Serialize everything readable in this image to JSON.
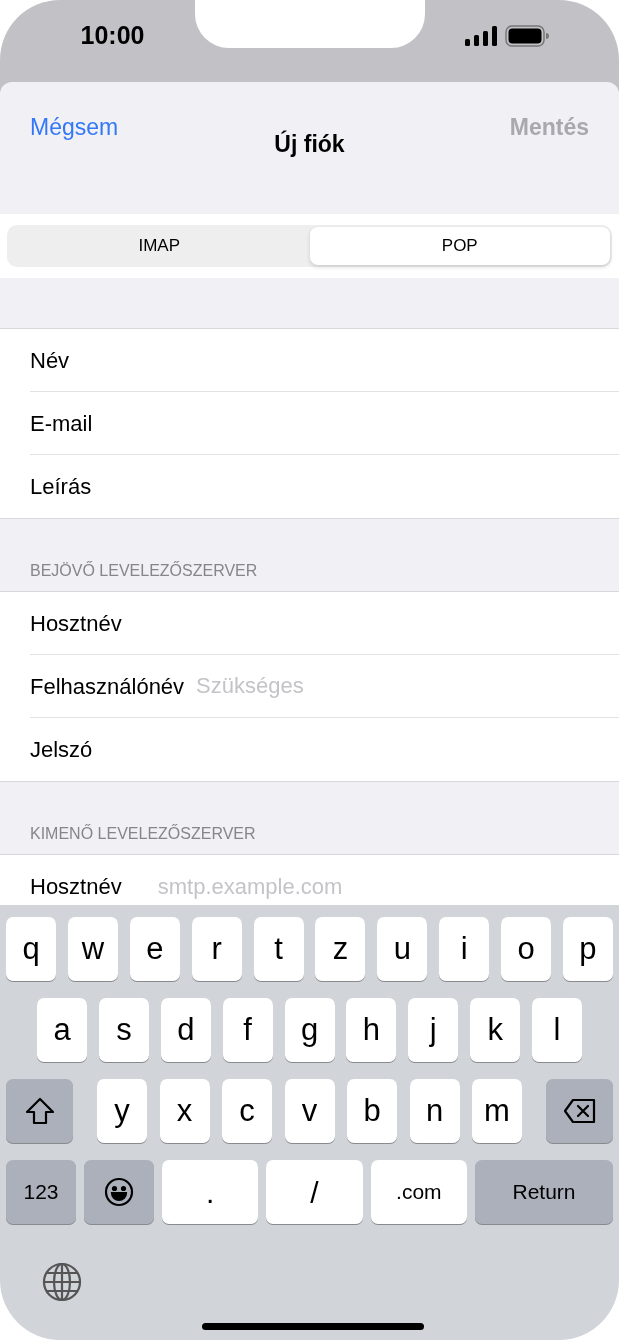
{
  "status_bar": {
    "time": "10:00"
  },
  "nav": {
    "cancel": {
      "label": "Mégsem",
      "disabled": false
    },
    "title": "Új fiók",
    "save": {
      "label": "Mentés",
      "disabled": true
    }
  },
  "segments": [
    {
      "label": "IMAP",
      "selected": false
    },
    {
      "label": "POP",
      "selected": true
    }
  ],
  "sections": [
    {
      "fields": [
        {
          "label": "Név"
        },
        {
          "label": "E-mail"
        },
        {
          "label": "Leírás"
        }
      ]
    },
    {
      "header": "BEJÖVŐ LEVELEZŐSZERVER",
      "fields": [
        {
          "label": "Hosztnév"
        },
        {
          "label": "Felhasználónév",
          "placeholder": "Szükséges"
        },
        {
          "label": "Jelszó"
        }
      ]
    },
    {
      "header": "KIMENŐ LEVELEZŐSZERVER",
      "fields": [
        {
          "label": "Hosztnév",
          "placeholder": "smtp.example.com"
        }
      ]
    }
  ],
  "keyboard": {
    "rows": [
      {
        "keys": [
          {
            "kind": "letter",
            "label": "q"
          },
          {
            "kind": "letter",
            "label": "w"
          },
          {
            "kind": "letter",
            "label": "e"
          },
          {
            "kind": "letter",
            "label": "r"
          },
          {
            "kind": "letter",
            "label": "t"
          },
          {
            "kind": "letter",
            "label": "z"
          },
          {
            "kind": "letter",
            "label": "u"
          },
          {
            "kind": "letter",
            "label": "i"
          },
          {
            "kind": "letter",
            "label": "o"
          },
          {
            "kind": "letter",
            "label": "p"
          }
        ]
      },
      {
        "keys": [
          {
            "kind": "letter",
            "label": "a"
          },
          {
            "kind": "letter",
            "label": "s"
          },
          {
            "kind": "letter",
            "label": "d"
          },
          {
            "kind": "letter",
            "label": "f"
          },
          {
            "kind": "letter",
            "label": "g"
          },
          {
            "kind": "letter",
            "label": "h"
          },
          {
            "kind": "letter",
            "label": "j"
          },
          {
            "kind": "letter",
            "label": "k"
          },
          {
            "kind": "letter",
            "label": "l"
          }
        ]
      },
      {
        "keys": [
          {
            "kind": "shift"
          },
          {
            "kind": "letter",
            "label": "y"
          },
          {
            "kind": "letter",
            "label": "x"
          },
          {
            "kind": "letter",
            "label": "c"
          },
          {
            "kind": "letter",
            "label": "v"
          },
          {
            "kind": "letter",
            "label": "b"
          },
          {
            "kind": "letter",
            "label": "n"
          },
          {
            "kind": "letter",
            "label": "m"
          },
          {
            "kind": "delete"
          }
        ]
      },
      {
        "keys": [
          {
            "kind": "numbers",
            "label": "123"
          },
          {
            "kind": "emoji"
          },
          {
            "kind": "symbol",
            "label": "."
          },
          {
            "kind": "symbol",
            "label": "/"
          },
          {
            "kind": "symbol",
            "label": ".com"
          },
          {
            "kind": "return",
            "label": "Return"
          }
        ]
      }
    ]
  }
}
